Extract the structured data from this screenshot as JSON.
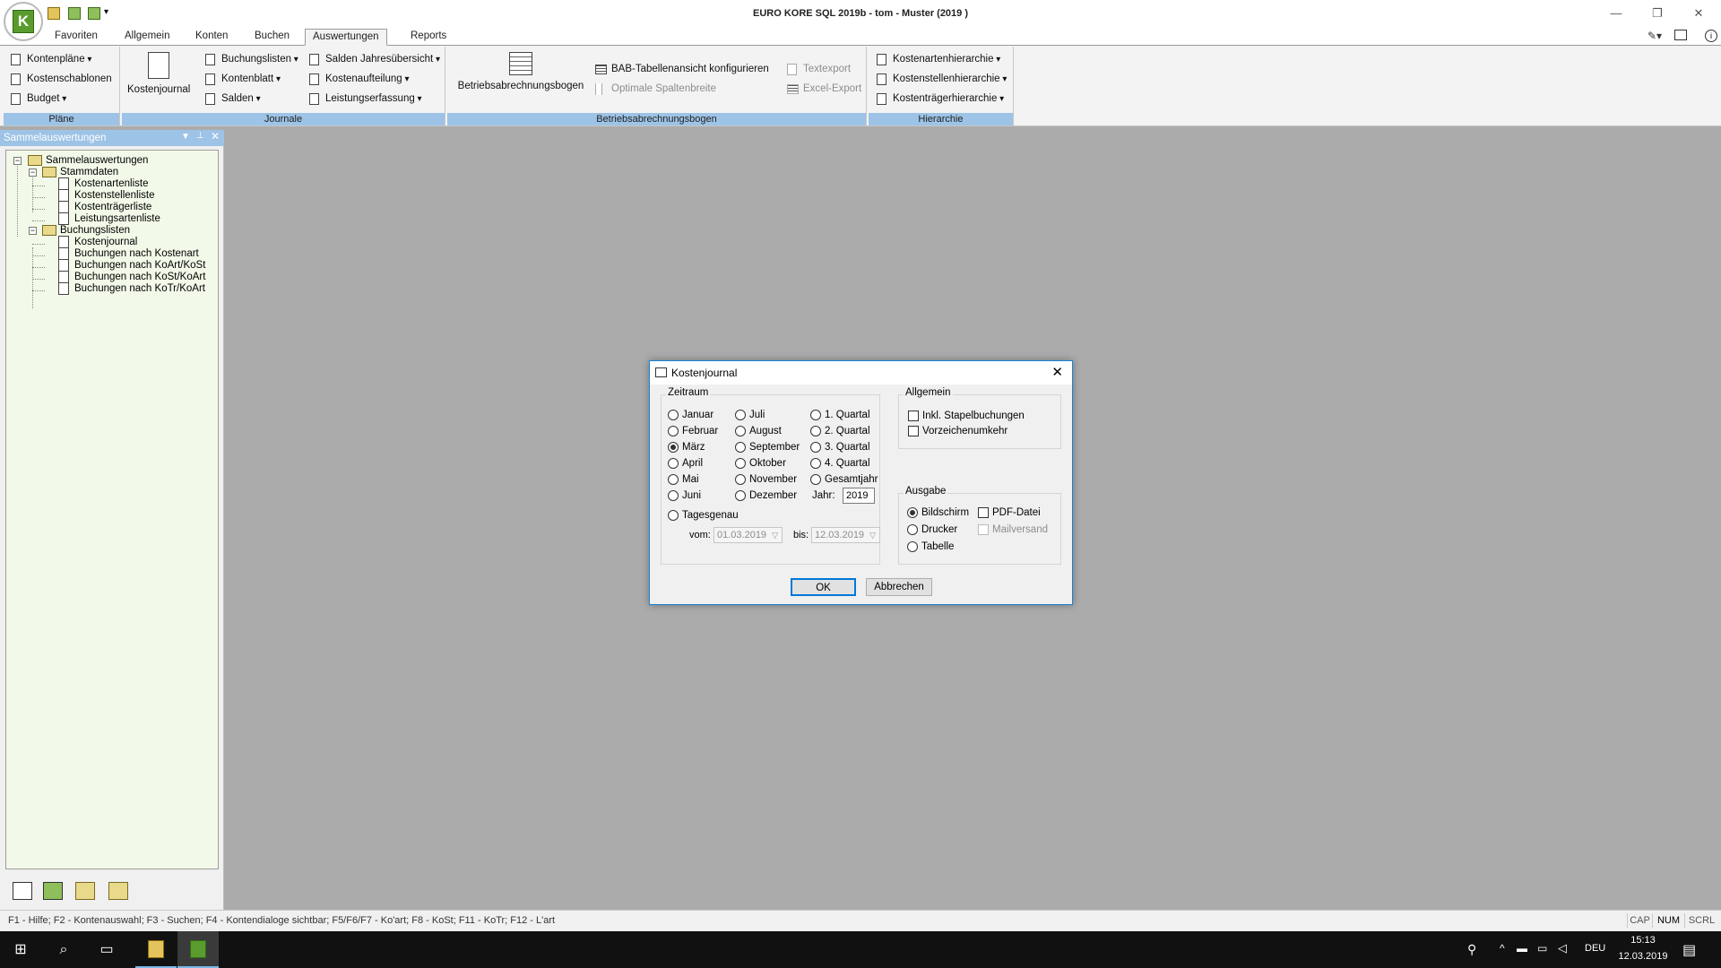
{
  "window": {
    "title": "EURO KORE SQL 2019b - tom - Muster (2019 )",
    "minimize": "—",
    "restore": "❐",
    "close": "✕"
  },
  "menu_tabs": [
    "Favoriten",
    "Allgemein",
    "Konten",
    "Buchen",
    "Auswertungen",
    "Reports"
  ],
  "active_tab": "Auswertungen",
  "ribbon": {
    "plaene": {
      "label": "Pläne",
      "items": [
        "Kontenpläne",
        "Kostenschablonen",
        "Budget"
      ]
    },
    "journale": {
      "label": "Journale",
      "big": "Kostenjournal",
      "col2": [
        "Buchungslisten",
        "Kontenblatt",
        "Salden"
      ],
      "col3": [
        "Salden Jahresübersicht",
        "Kostenaufteilung",
        "Leistungserfassung"
      ]
    },
    "bab": {
      "label": "Betriebsabrechnungsbogen",
      "big": "Betriebsabrechnungsbogen",
      "config": "BAB-Tabellenansicht konfigurieren",
      "optimal": "Optimale Spaltenbreite",
      "textexport": "Textexport",
      "excel": "Excel-Export"
    },
    "hierarchie": {
      "label": "Hierarchie",
      "items": [
        "Kostenartenhierarchie",
        "Kostenstellenhierarchie",
        "Kostenträgerhierarchie"
      ]
    }
  },
  "panel": {
    "title": "Sammelauswertungen",
    "tree": {
      "root": "Sammelauswertungen",
      "stammdaten": "Stammdaten",
      "stamm_items": [
        "Kostenartenliste",
        "Kostenstellenliste",
        "Kostenträgerliste",
        "Leistungsartenliste"
      ],
      "buchungslisten": "Buchungslisten",
      "buch_items": [
        "Kostenjournal",
        "Buchungen nach Kostenart",
        "Buchungen nach KoArt/KoSt",
        "Buchungen nach KoSt/KoArt",
        "Buchungen nach KoTr/KoArt"
      ]
    }
  },
  "statusbar": {
    "text": "F1 - Hilfe; F2 - Kontenauswahl; F3 - Suchen; F4 - Kontendialoge sichtbar; F5/F6/F7 - Ko'art; F8 - KoSt; F11 - KoTr; F12 - L'art",
    "cap": "CAP",
    "num": "NUM",
    "scrl": "SCRL"
  },
  "taskbar": {
    "lang": "DEU",
    "time": "15:13",
    "date": "12.03.2019"
  },
  "dialog": {
    "title": "Kostenjournal",
    "zeitraum": {
      "label": "Zeitraum",
      "col1": [
        "Januar",
        "Februar",
        "März",
        "April",
        "Mai",
        "Juni"
      ],
      "col2": [
        "Juli",
        "August",
        "September",
        "Oktober",
        "November",
        "Dezember"
      ],
      "col3": [
        "1. Quartal",
        "2. Quartal",
        "3. Quartal",
        "4. Quartal",
        "Gesamtjahr"
      ],
      "selected": "März",
      "jahr_label": "Jahr:",
      "jahr": "2019",
      "tagesgenau": "Tagesgenau",
      "vom_label": "vom:",
      "vom": "01.03.2019",
      "bis_label": "bis:",
      "bis": "12.03.2019"
    },
    "allgemein": {
      "label": "Allgemein",
      "options": [
        "Inkl. Stapelbuchungen",
        "Vorzeichenumkehr"
      ]
    },
    "ausgabe": {
      "label": "Ausgabe",
      "options": [
        "Bildschirm",
        "Drucker",
        "Tabelle"
      ],
      "selected": "Bildschirm",
      "pdf": "PDF-Datei",
      "mail": "Mailversand"
    },
    "ok": "OK",
    "cancel": "Abbrechen"
  }
}
